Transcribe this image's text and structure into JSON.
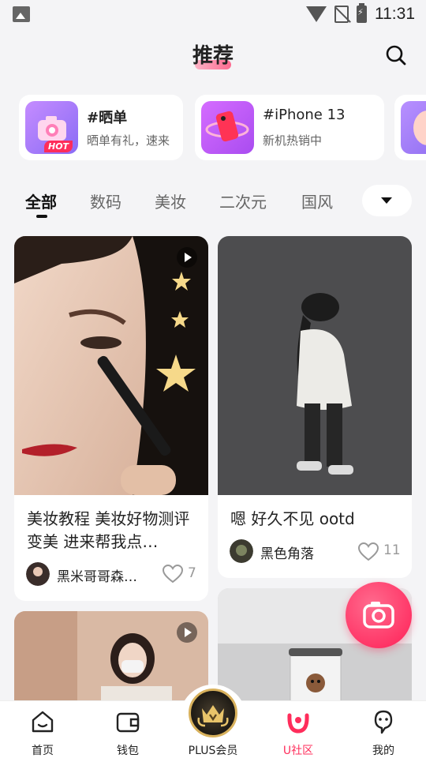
{
  "status_bar": {
    "time": "11:31"
  },
  "header": {
    "title": "推荐"
  },
  "topics": [
    {
      "title": "#晒单",
      "subtitle": "晒单有礼，速来",
      "badge": "HOT",
      "icon": "camera-icon"
    },
    {
      "title": "#iPhone 13",
      "subtitle": "新机热销中",
      "icon": "phone-icon"
    }
  ],
  "tabs": [
    "全部",
    "数码",
    "美妆",
    "二次元",
    "国风"
  ],
  "feed": [
    {
      "title": "美妆教程  美妆好物测评  变美 进来帮我点…",
      "author": "黑米哥哥森碟…",
      "likes": "7",
      "video": true
    },
    {
      "title": "嗯 好久不见  ootd",
      "author": "黑色角落",
      "likes": "11",
      "video": false
    },
    {
      "video": true
    }
  ],
  "bottom_nav": [
    {
      "label": "首页",
      "icon": "home-icon"
    },
    {
      "label": "钱包",
      "icon": "wallet-icon"
    },
    {
      "label": "PLUS会员",
      "icon": "crown-icon"
    },
    {
      "label": "U社区",
      "icon": "community-icon",
      "active": true
    },
    {
      "label": "我的",
      "icon": "profile-icon"
    }
  ],
  "colors": {
    "accent": "#ff2d5b",
    "background": "#f4f4f6"
  }
}
